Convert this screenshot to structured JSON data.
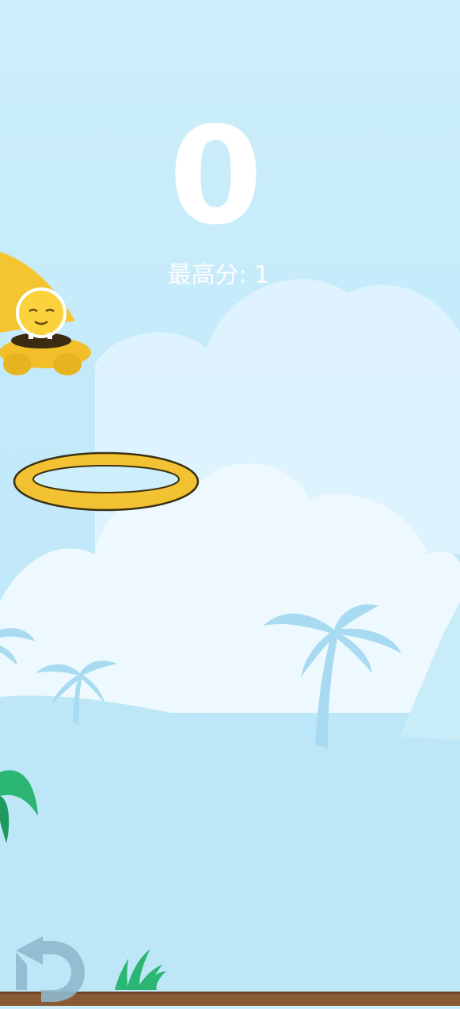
{
  "hud": {
    "score": "0",
    "best_label": "最高分: 1"
  },
  "controls": {
    "restart_icon": "restart-icon"
  },
  "colors": {
    "sky_top": "#cdeefb",
    "sky_bottom": "#b6e4f7",
    "cloud": "#e8f7fd",
    "palm_silhouette": "#a9dcf2",
    "ufo_yellow": "#f5c431",
    "ring_yellow": "#f2c232",
    "leaf_green": "#2bb673",
    "ground": "#8a5a34"
  }
}
